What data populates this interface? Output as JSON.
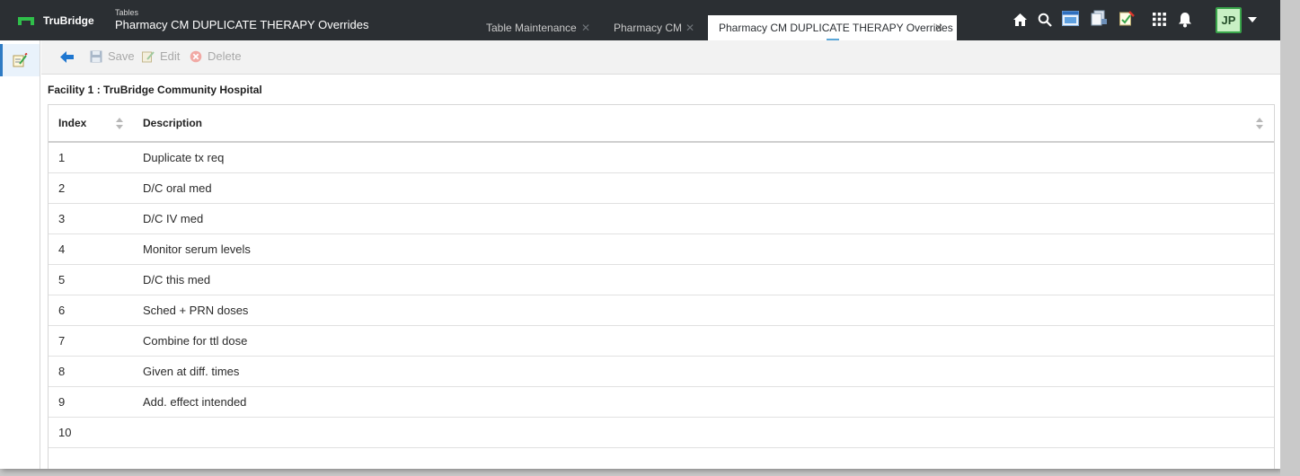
{
  "app": {
    "brand": "TruBridge",
    "breadcrumb_sup": "Tables",
    "title": "Pharmacy CM DUPLICATE THERAPY Overrides",
    "user_initials": "JP",
    "brand_color": "#2fbf4a",
    "header_bg": "#2b2f33"
  },
  "tabs": [
    {
      "label": "Table Maintenance",
      "active": false
    },
    {
      "label": "Pharmacy CM",
      "active": false
    },
    {
      "label": "Pharmacy CM DUPLICATE THERAPY Overrides",
      "active": true
    }
  ],
  "header_icons": [
    "home-icon",
    "search-icon",
    "window-icon",
    "documents-icon",
    "notes-check-icon",
    "apps-grid-icon",
    "bell-icon"
  ],
  "sidebar": {
    "items": [
      {
        "icon": "edit-note-icon",
        "active": true
      }
    ]
  },
  "toolbar": {
    "back_icon": "arrow-left-icon",
    "save_label": "Save",
    "edit_label": "Edit",
    "delete_label": "Delete"
  },
  "facility": "Facility 1 : TruBridge Community Hospital",
  "grid": {
    "columns": [
      "Index",
      "Description"
    ],
    "rows": [
      {
        "index": "1",
        "description": "Duplicate tx req"
      },
      {
        "index": "2",
        "description": "D/C oral med"
      },
      {
        "index": "3",
        "description": "D/C IV med"
      },
      {
        "index": "4",
        "description": "Monitor serum levels"
      },
      {
        "index": "5",
        "description": "D/C this med"
      },
      {
        "index": "6",
        "description": "Sched + PRN doses"
      },
      {
        "index": "7",
        "description": "Combine for ttl dose"
      },
      {
        "index": "8",
        "description": "Given at diff. times"
      },
      {
        "index": "9",
        "description": "Add. effect intended"
      },
      {
        "index": "10",
        "description": ""
      }
    ]
  }
}
